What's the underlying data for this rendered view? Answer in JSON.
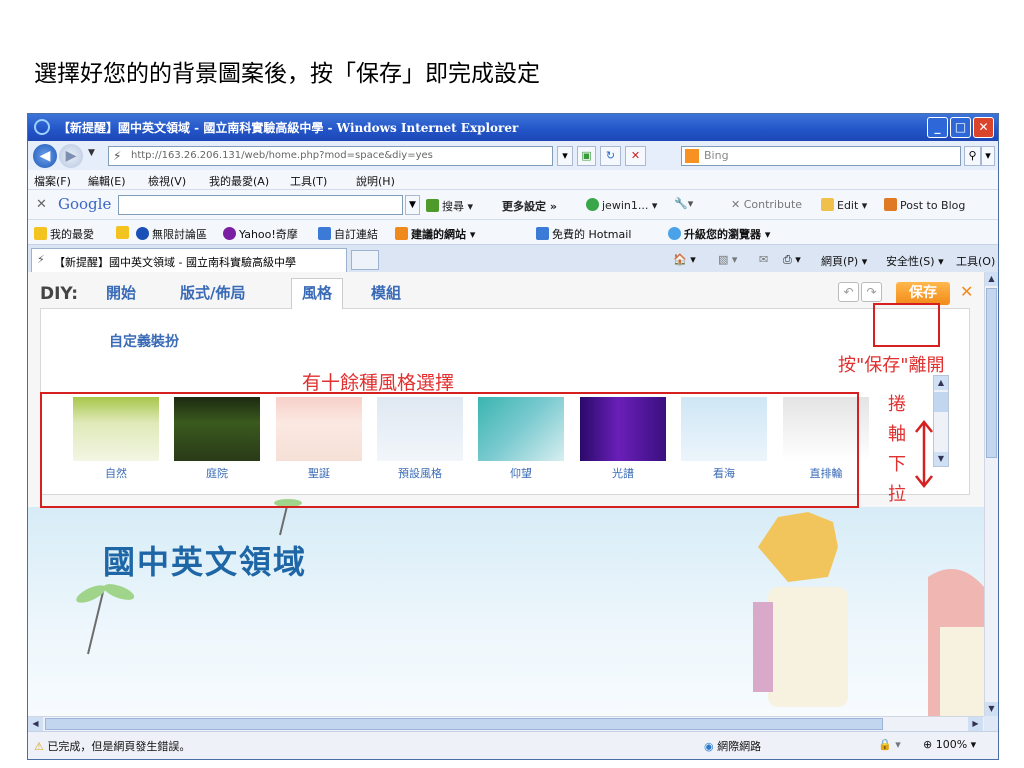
{
  "slide": {
    "title": "選擇好您的的背景圖案後，按「保存」即完成設定"
  },
  "window": {
    "title": "【新提醒】國中英文領域 - 國立南科實驗高級中學 - Windows Internet Explorer"
  },
  "address": {
    "url": "http://163.26.206.131/web/home.php?mod=space&diy=yes",
    "search_placeholder": "Bing"
  },
  "menu": [
    "檔案(F)",
    "編輯(E)",
    "檢視(V)",
    "我的最愛(A)",
    "工具(T)",
    "說明(H)"
  ],
  "google_bar": {
    "brand": "Google",
    "search": "搜尋",
    "more": "更多設定 »",
    "user": "jewin1...",
    "contribute": "Contribute",
    "edit": "Edit",
    "post": "Post to Blog"
  },
  "favorites": {
    "label": "我的最愛",
    "items": [
      "無限討論區",
      "Yahoo!奇摩",
      "自訂連結",
      "建議的網站",
      "免費的 Hotmail",
      "升級您的瀏覽器"
    ]
  },
  "tab": {
    "title": "【新提醒】國中英文領域 - 國立南科實驗高級中學"
  },
  "commands": {
    "page": "網頁(P)",
    "safety": "安全性(S)",
    "tools": "工具(O)"
  },
  "diy": {
    "label": "DIY:",
    "tabs": [
      "開始",
      "版式/佈局",
      "風格",
      "模組"
    ],
    "active_tab": "風格",
    "save": "保存",
    "custom_label": "自定義裝扮",
    "styles": [
      "自然",
      "庭院",
      "聖誕",
      "預設風格",
      "仰望",
      "光譜",
      "看海",
      "直排輪"
    ]
  },
  "page": {
    "heading": "國中英文領域"
  },
  "annotations": {
    "save_note": "按\"保存\"離開",
    "styles_note": "有十餘種風格選擇",
    "scroll_note": [
      "捲",
      "軸",
      "下",
      "拉"
    ]
  },
  "status": {
    "text": "已完成，但是網頁發生錯誤。",
    "zone": "網際網路",
    "zoom": "100%"
  },
  "colors": {
    "annotation_red": "#d62020",
    "diy_blue": "#3a6bb6",
    "save_orange": "#f28a18",
    "titlebar": "#2254c7"
  }
}
